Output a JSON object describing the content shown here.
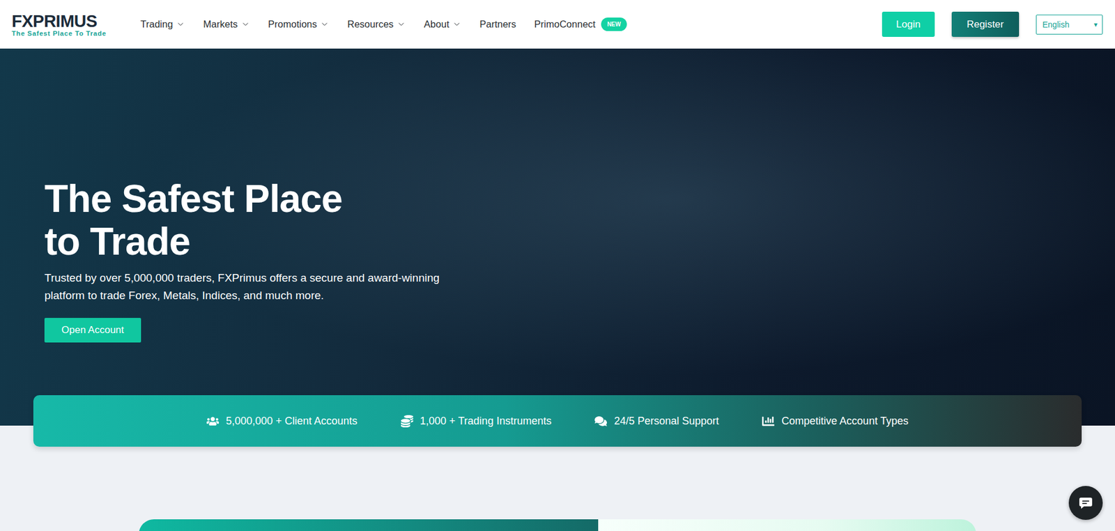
{
  "header": {
    "logo": "FXPRIMUS",
    "tagline": "The Safest Place To Trade",
    "nav": [
      {
        "label": "Trading",
        "dropdown": true
      },
      {
        "label": "Markets",
        "dropdown": true
      },
      {
        "label": "Promotions",
        "dropdown": true
      },
      {
        "label": "Resources",
        "dropdown": true
      },
      {
        "label": "About",
        "dropdown": true
      },
      {
        "label": "Partners",
        "dropdown": false
      },
      {
        "label": "PrimoConnect",
        "dropdown": false,
        "badge": "NEW"
      }
    ],
    "login": "Login",
    "register": "Register",
    "language": {
      "value": "English",
      "arrow": "▾"
    }
  },
  "hero": {
    "title_lines": [
      "The Safest Place",
      "to Trade"
    ],
    "subtitle": "Trusted by over 5,000,000 traders, FXPrimus offers a secure and award-winning platform to trade Forex, Metals, Indices, and much more.",
    "cta": "Open Account"
  },
  "stats": [
    {
      "label": "5,000,000 + Client Accounts"
    },
    {
      "label": "1,000 + Trading Instruments"
    },
    {
      "label": "24/5 Personal Support"
    },
    {
      "label": "Competitive Account Types"
    }
  ]
}
